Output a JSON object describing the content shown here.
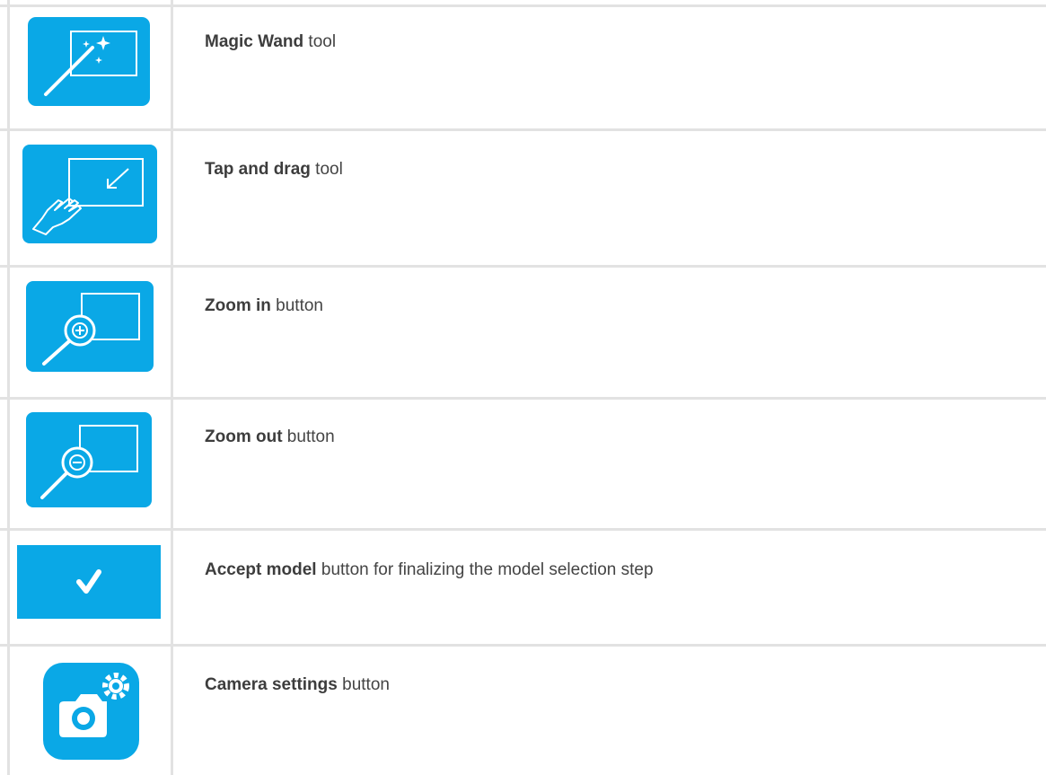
{
  "rows": [
    {
      "icon": "magic-wand-icon",
      "name": "Magic Wand",
      "rest": " tool"
    },
    {
      "icon": "tap-and-drag-icon",
      "name": "Tap and drag",
      "rest": " tool"
    },
    {
      "icon": "zoom-in-icon",
      "name": "Zoom in",
      "rest": " button"
    },
    {
      "icon": "zoom-out-icon",
      "name": "Zoom out",
      "rest": " button"
    },
    {
      "icon": "checkmark-icon",
      "name": "Accept model",
      "rest": " button for finalizing the model selection step"
    },
    {
      "icon": "camera-settings-icon",
      "name": "Camera settings",
      "rest": " button"
    }
  ],
  "colors": {
    "accent": "#0aa8e6",
    "border": "#e2e2e2",
    "text": "#444444"
  }
}
